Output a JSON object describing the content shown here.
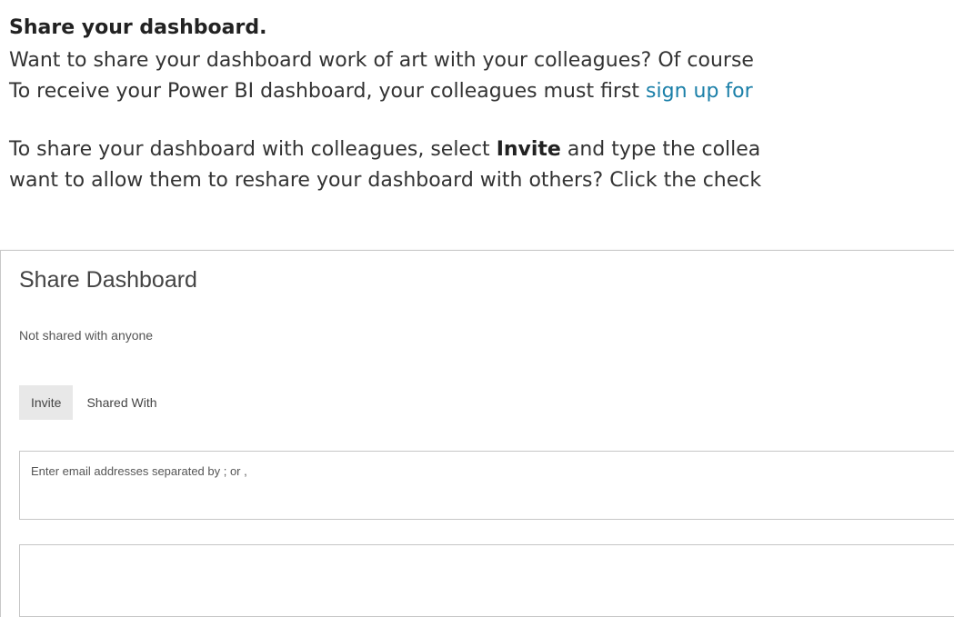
{
  "article": {
    "heading": "Share your dashboard.",
    "paragraph1": {
      "line1": "Want to share your dashboard work of art with your colleagues? Of course",
      "line2_before_link": "To receive your Power BI dashboard, your colleagues must first ",
      "line2_link": "sign up for"
    },
    "paragraph2": {
      "line1_before_bold": "To share your dashboard with colleagues, select ",
      "line1_bold": "Invite",
      "line1_after_bold": " and type the collea",
      "line2": "want to allow them to reshare your dashboard with others? Click the check"
    },
    "link_color": "#1a7fa8"
  },
  "dialog": {
    "title": "Share Dashboard",
    "status": "Not shared with anyone",
    "tabs": [
      {
        "label": "Invite",
        "active": true
      },
      {
        "label": "Shared With",
        "active": false
      }
    ],
    "email_input": {
      "placeholder": "Enter email addresses separated by ; or ,",
      "value": ""
    },
    "message_input": {
      "placeholder": "",
      "value": ""
    }
  }
}
